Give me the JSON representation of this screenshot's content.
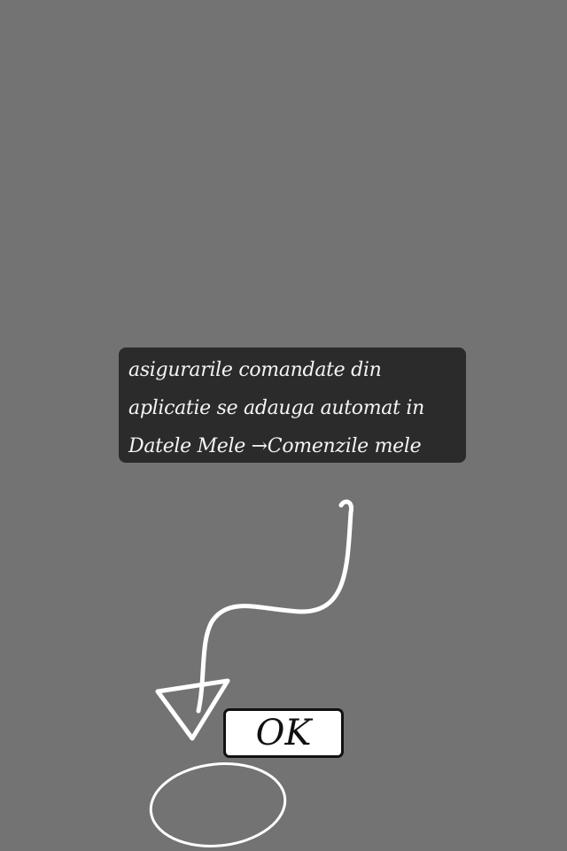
{
  "overlay": {
    "background_color": "#737373"
  },
  "tooltip": {
    "lines": [
      "asigurarile comandate din",
      "aplicatie se adauga automat in",
      "Datele Mele →Comenzile mele"
    ],
    "background_color": "#2b2b2b",
    "text_color": "#f4f4f4"
  },
  "hint": {
    "arrow_icon": "curved-down-arrow-icon",
    "target_icon": "circle-highlight-icon",
    "stroke_color": "#ffffff"
  },
  "ok_button": {
    "label": "OK"
  }
}
